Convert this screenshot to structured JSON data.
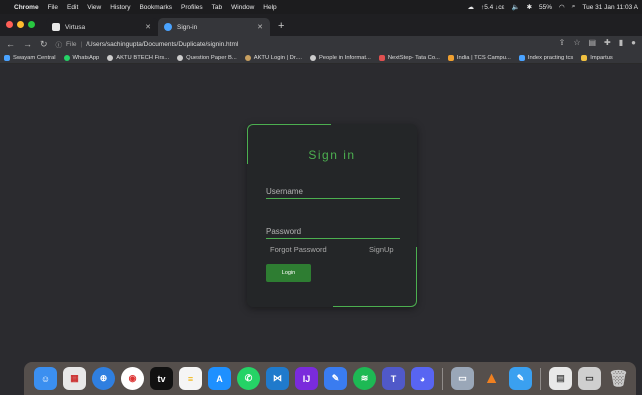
{
  "menubar": {
    "app": "Chrome",
    "items": [
      "File",
      "Edit",
      "View",
      "History",
      "Bookmarks",
      "Profiles",
      "Tab",
      "Window",
      "Help"
    ],
    "status": {
      "speed": "↑5.4 ↓cε",
      "battery": "55%",
      "datetime": "Tue 31 Jan 11:03 A"
    }
  },
  "tabs": [
    {
      "label": "Virtusa",
      "fav_color": "#e8e8e8"
    },
    {
      "label": "Sign-in",
      "fav_color": "#4aa3ff"
    }
  ],
  "toolbar": {
    "info": "ⓘ",
    "scheme": "File",
    "url": "/Users/sachingupta/Documents/Duplicate/signin.html"
  },
  "bookmarks": [
    {
      "label": "Swayam Central",
      "color": "#4aa3ff"
    },
    {
      "label": "WhatsApp",
      "color": "#25d366"
    },
    {
      "label": "AKTU BTECH Firs...",
      "color": "#cccccc"
    },
    {
      "label": "Question Paper B...",
      "color": "#cccccc"
    },
    {
      "label": "AKTU Login | Dr....",
      "color": "#c8a060"
    },
    {
      "label": "People in Informat...",
      "color": "#cccccc"
    },
    {
      "label": "NextStep- Tata Co...",
      "color": "#e05050"
    },
    {
      "label": "India | TCS Campu...",
      "color": "#f0a030"
    },
    {
      "label": "Index practing tcs",
      "color": "#4aa3ff"
    },
    {
      "label": "Impartus",
      "color": "#f0c040"
    }
  ],
  "signin": {
    "title": "Sign in",
    "username_placeholder": "Username",
    "password_placeholder": "Password",
    "forgot_label": "Forgot Password",
    "signup_label": "SignUp",
    "login_label": "Login",
    "accent": "#4caf50",
    "button_color": "#2e7d32"
  }
}
